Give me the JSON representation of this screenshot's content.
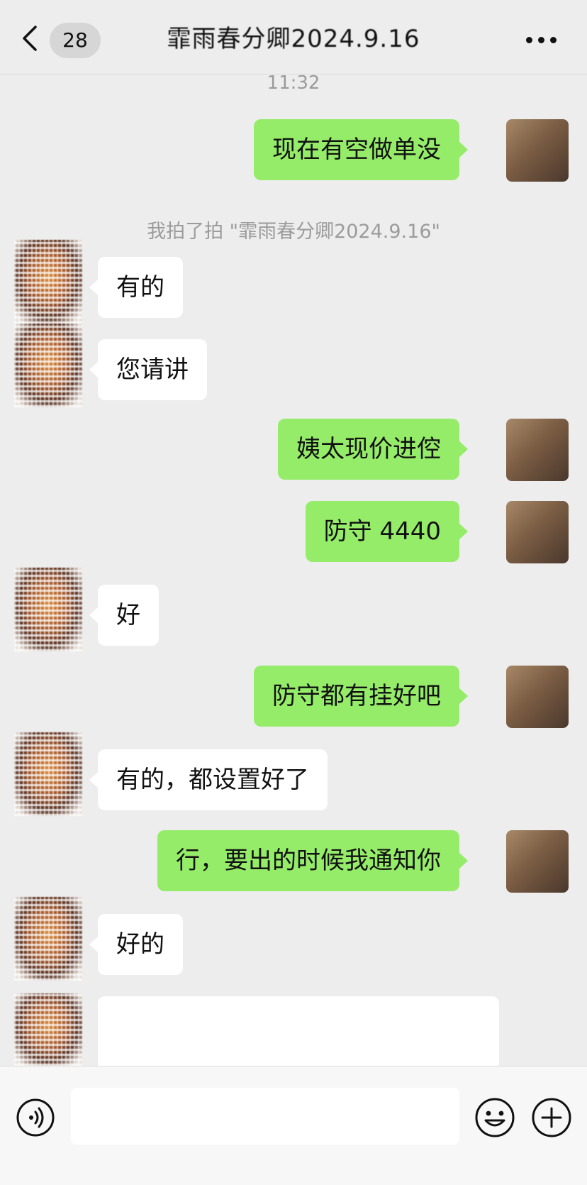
{
  "header": {
    "back_badge": "28",
    "title": "霏雨春分卿2024.9.16"
  },
  "chat": {
    "time": "11:32",
    "system_note": "我拍了拍 \"霏雨春分卿2024.9.16\"",
    "messages": [
      {
        "side": "right",
        "text": "现在有空做单没"
      },
      {
        "side": "left",
        "text": "有的"
      },
      {
        "side": "left",
        "text": "您请讲"
      },
      {
        "side": "right",
        "text": "姨太现价进倥"
      },
      {
        "side": "right",
        "text": "防守 4440"
      },
      {
        "side": "left",
        "text": "好"
      },
      {
        "side": "right",
        "text": "防守都有挂好吧"
      },
      {
        "side": "left",
        "text": "有的，都设置好了"
      },
      {
        "side": "right",
        "text": "行，要出的时候我通知你"
      },
      {
        "side": "left",
        "text": "好的"
      }
    ]
  },
  "input_bar": {
    "message_value": "",
    "icons": [
      "voice-icon",
      "emoji-icon",
      "plus-icon"
    ]
  },
  "colors": {
    "background": "#ededed",
    "sent_bubble": "#95ec69",
    "received_bubble": "#ffffff"
  }
}
